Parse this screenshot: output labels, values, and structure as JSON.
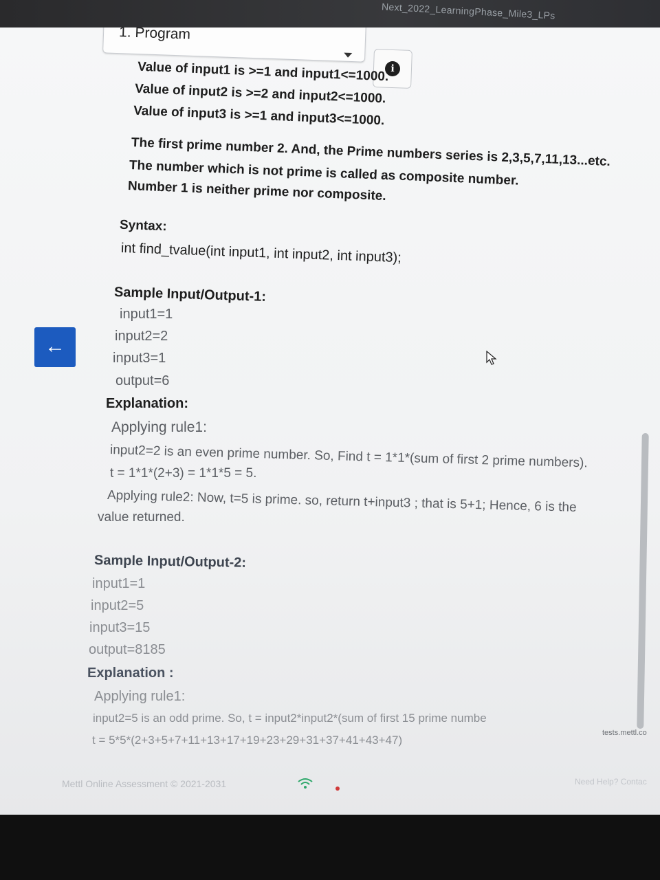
{
  "window": {
    "title_fragment": "Next_2022_LearningPhase_Mile3_LPs"
  },
  "question_selector": {
    "label": "1. Program"
  },
  "info_button": {
    "icon": "info-icon",
    "glyph": "i"
  },
  "back_button": {
    "icon": "arrow-left-icon",
    "glyph": "←"
  },
  "constraints": [
    "Value of input1 is >=1 and input1<=1000.",
    "Value of input2 is >=2 and input2<=1000.",
    "Value of input3 is >=1 and input3<=1000.",
    "The first prime number  2. And, the Prime numbers series is 2,3,5,7,11,13...etc.",
    "The number which is not prime is called as composite number.",
    "Number 1 is neither prime nor composite."
  ],
  "syntax": {
    "heading": "Syntax:",
    "signature": "int find_tvalue(int input1, int input2, int input3);"
  },
  "sample1": {
    "heading": "Sample Input/Output-1:",
    "lines": [
      "input1=1",
      "input2=2",
      "input3=1",
      "output=6"
    ],
    "explanation_heading": "Explanation:",
    "explanation": [
      "Applying rule1:",
      "input2=2 is an even prime number.   So, Find t = 1*1*(sum of first 2 prime numbers).",
      "t = 1*1*(2+3) = 1*1*5 = 5.",
      "Applying rule2:   Now, t=5 is prime. so, return t+input3 ; that is 5+1;    Hence, 6 is the",
      "value returned."
    ]
  },
  "sample2": {
    "heading": "Sample Input/Output-2:",
    "lines": [
      "input1=1",
      "input2=5",
      "input3=15",
      "output=8185"
    ],
    "explanation_heading": "Explanation :",
    "explanation": [
      "Applying rule1:",
      "input2=5 is an odd  prime.   So, t = input2*input2*(sum of first 15 prime numbe",
      "t = 5*5*(2+3+5+7+11+13+17+19+23+29+31+37+41+43+47)"
    ]
  },
  "footer": {
    "copyright": "Mettl Online Assessment © 2021-2031",
    "need_help": "Need Help? Contac",
    "url": "tests.mettl.co"
  }
}
